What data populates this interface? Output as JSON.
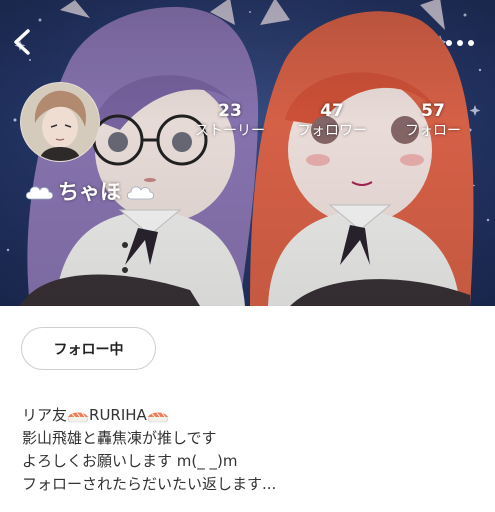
{
  "header": {
    "back_icon": "chevron-left-icon",
    "more_icon": "more-horizontal-icon"
  },
  "profile": {
    "name": "ちゃほ",
    "name_prefix_icon": "cloud-icon",
    "name_suffix_icon": "cloud-icon",
    "stats": [
      {
        "value": "23",
        "label": "ストーリー"
      },
      {
        "value": "47",
        "label": "フォロワー"
      },
      {
        "value": "57",
        "label": "フォロー"
      }
    ]
  },
  "actions": {
    "follow_label": "フォロー中"
  },
  "bio": {
    "line1_a": "リア友",
    "line1_icon": "sushi-icon",
    "line1_b": "RURIHA",
    "line2": "影山飛雄と轟焦凍が推しです",
    "line3": "よろしくお願いします m(_ _)m",
    "line4": "フォローされたらだいたい返します..."
  },
  "colors": {
    "cover_bg": "#26386a",
    "hair_left": "#8d78b7",
    "hair_right": "#e0654a",
    "text_primary": "#333333",
    "button_border": "#cfcfcf"
  }
}
